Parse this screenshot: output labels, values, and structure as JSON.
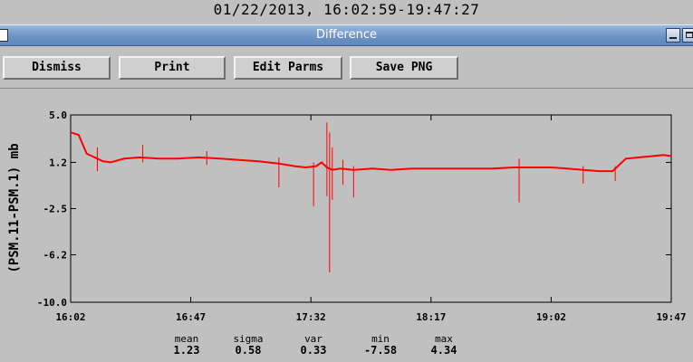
{
  "header": {
    "date_range": "01/22/2013, 16:02:59-19:47:27"
  },
  "window": {
    "title": "Difference"
  },
  "toolbar": {
    "buttons": [
      {
        "label": "Dismiss"
      },
      {
        "label": "Print"
      },
      {
        "label": "Edit Parms"
      },
      {
        "label": "Save PNG"
      }
    ]
  },
  "chart_data": {
    "type": "line",
    "ylabel": "(PSM.11-PSM.1) mb",
    "xlabel": "",
    "y_ticks": [
      "5.0",
      "1.2",
      "-2.5",
      "-6.2",
      "-10.0"
    ],
    "y_tick_values": [
      5.0,
      1.2,
      -2.5,
      -6.2,
      -10.0
    ],
    "ylim": [
      -10.0,
      5.0
    ],
    "x_ticks": [
      "16:02",
      "16:47",
      "17:32",
      "18:17",
      "19:02",
      "19:47"
    ],
    "xlim": [
      "16:02",
      "19:47"
    ],
    "series": [
      {
        "color": "#ff0000",
        "x": [
          "16:02",
          "16:05",
          "16:08",
          "16:11",
          "16:14",
          "16:17",
          "16:22",
          "16:28",
          "16:35",
          "16:42",
          "16:50",
          "16:58",
          "17:05",
          "17:12",
          "17:20",
          "17:26",
          "17:30",
          "17:34",
          "17:36",
          "17:38",
          "17:40",
          "17:43",
          "17:48",
          "17:55",
          "18:02",
          "18:10",
          "18:17",
          "18:25",
          "18:32",
          "18:40",
          "18:48",
          "18:55",
          "19:02",
          "19:08",
          "19:14",
          "19:20",
          "19:25",
          "19:30",
          "19:35",
          "19:40",
          "19:44",
          "19:47"
        ],
        "y": [
          3.6,
          3.4,
          1.9,
          1.6,
          1.3,
          1.2,
          1.5,
          1.6,
          1.5,
          1.5,
          1.6,
          1.5,
          1.4,
          1.3,
          1.1,
          0.9,
          0.8,
          0.9,
          1.2,
          0.8,
          0.6,
          0.7,
          0.6,
          0.7,
          0.6,
          0.7,
          0.7,
          0.7,
          0.7,
          0.7,
          0.8,
          0.8,
          0.8,
          0.7,
          0.6,
          0.5,
          0.5,
          1.5,
          1.6,
          1.7,
          1.8,
          1.7
        ]
      }
    ],
    "spikes": [
      {
        "x": "16:12",
        "low": 0.5,
        "high": 2.4
      },
      {
        "x": "16:29",
        "low": 1.2,
        "high": 2.6
      },
      {
        "x": "16:53",
        "low": 1.0,
        "high": 2.1
      },
      {
        "x": "17:20",
        "low": -0.8,
        "high": 1.6
      },
      {
        "x": "17:33",
        "low": -2.3,
        "high": 1.2
      },
      {
        "x": "17:38",
        "low": -1.5,
        "high": 4.4
      },
      {
        "x": "17:39",
        "low": -7.6,
        "high": 3.6
      },
      {
        "x": "17:40",
        "low": -1.8,
        "high": 2.4
      },
      {
        "x": "17:44",
        "low": -0.6,
        "high": 1.4
      },
      {
        "x": "17:48",
        "low": -1.6,
        "high": 0.9
      },
      {
        "x": "18:50",
        "low": -2.0,
        "high": 1.5
      },
      {
        "x": "19:14",
        "low": -0.5,
        "high": 0.9
      },
      {
        "x": "19:26",
        "low": -0.3,
        "high": 0.9
      }
    ]
  },
  "stats": [
    {
      "label": "mean",
      "value": "1.23"
    },
    {
      "label": "sigma",
      "value": "0.58"
    },
    {
      "label": "var",
      "value": "0.33"
    },
    {
      "label": "min",
      "value": "-7.58"
    },
    {
      "label": "max",
      "value": "4.34"
    }
  ]
}
